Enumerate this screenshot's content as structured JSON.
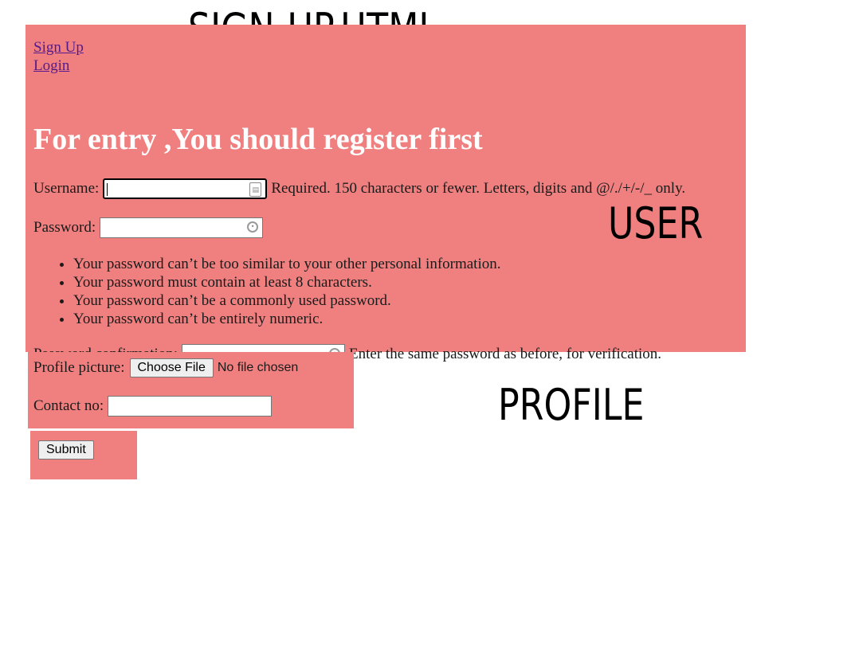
{
  "annotations": {
    "title": "SIGN-UP.HTML",
    "user": "USER",
    "profile": "PROFILE"
  },
  "nav": {
    "signup": "Sign Up",
    "login": "Login"
  },
  "heading": "For entry ,You should register first",
  "username": {
    "label": "Username:",
    "value": "",
    "help": "Required. 150 characters or fewer. Letters, digits and @/./+/-/_ only."
  },
  "password": {
    "label": "Password:",
    "value": "",
    "rules": [
      "Your password can’t be too similar to your other personal information.",
      "Your password must contain at least 8 characters.",
      "Your password can’t be a commonly used password.",
      "Your password can’t be entirely numeric."
    ]
  },
  "confirm": {
    "label": "Password confirmation:",
    "value": "",
    "help": "Enter the same password as before, for verification."
  },
  "profile": {
    "label": "Profile picture:",
    "button": "Choose File",
    "status": "No file chosen"
  },
  "contact": {
    "label": "Contact no:",
    "value": ""
  },
  "submit": "Submit",
  "colors": {
    "panel": "#f08080",
    "heading": "#ffffff",
    "link": "#551a8b"
  }
}
